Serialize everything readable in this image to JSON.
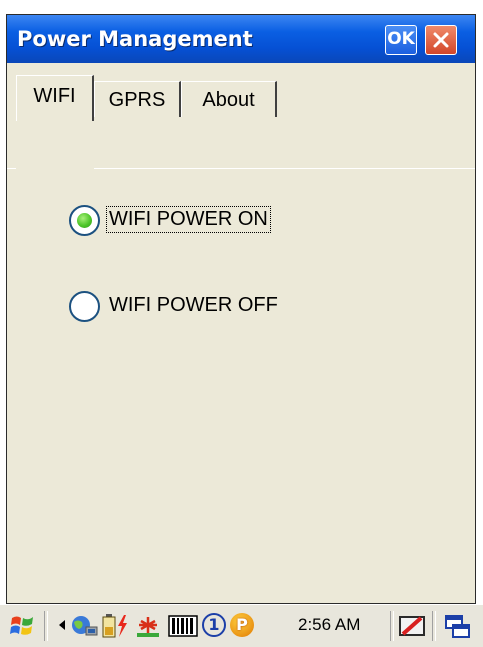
{
  "window": {
    "title": "Power Management",
    "ok_label": "OK"
  },
  "tabs": [
    {
      "label": "WIFI",
      "active": true
    },
    {
      "label": "GPRS",
      "active": false
    },
    {
      "label": "About",
      "active": false
    }
  ],
  "options": [
    {
      "label": "WIFI POWER ON",
      "selected": true
    },
    {
      "label": "WIFI POWER OFF",
      "selected": false
    }
  ],
  "taskbar": {
    "time": "2:56 AM",
    "icons": [
      "start-flag-icon",
      "scroll-left-icon",
      "network-icon",
      "battery-icon",
      "antenna-icon",
      "barcode-icon",
      "numbered-circle-icon",
      "p-circle-icon",
      "pen-icon",
      "window-switch-icon"
    ],
    "number_badge": "1",
    "p_badge": "P"
  },
  "colors": {
    "titlebar": "#0650d4",
    "window_bg": "#ece9d8",
    "close": "#d2462a",
    "radio_selected": "#4ec62a"
  }
}
